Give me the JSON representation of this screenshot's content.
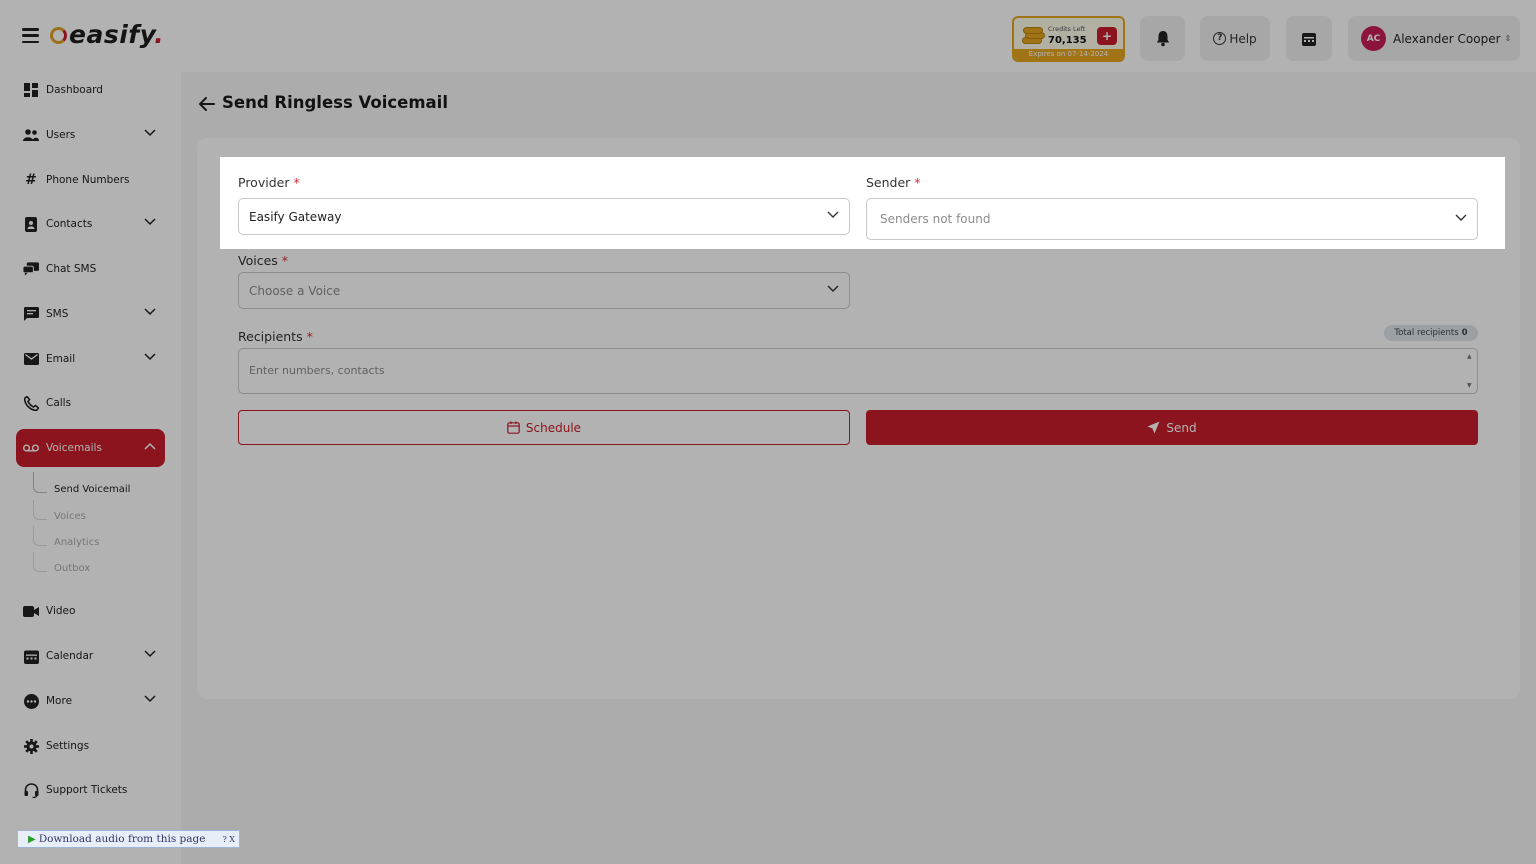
{
  "app": {
    "logo": "easify",
    "logo_dot": "."
  },
  "credits": {
    "label": "Credits Left",
    "value": "70,135",
    "plus": "+",
    "expires": "Expires on 07-14-2024"
  },
  "header": {
    "help_label": "Help",
    "user_initials": "AC",
    "user_name": "Alexander Cooper"
  },
  "sidebar": {
    "items": [
      {
        "label": "Dashboard"
      },
      {
        "label": "Users"
      },
      {
        "label": "Phone Numbers"
      },
      {
        "label": "Contacts"
      },
      {
        "label": "Chat SMS"
      },
      {
        "label": "SMS"
      },
      {
        "label": "Email"
      },
      {
        "label": "Calls"
      },
      {
        "label": "Voicemails"
      },
      {
        "label": "Video"
      },
      {
        "label": "Calendar"
      },
      {
        "label": "More"
      },
      {
        "label": "Settings"
      },
      {
        "label": "Support Tickets"
      }
    ],
    "voicemail_sub": [
      {
        "label": "Send Voicemail"
      },
      {
        "label": "Voices"
      },
      {
        "label": "Analytics"
      },
      {
        "label": "Outbox"
      }
    ]
  },
  "page": {
    "title": "Send Ringless Voicemail"
  },
  "form": {
    "provider_label": "Provider",
    "provider_value": "Easify Gateway",
    "sender_label": "Sender",
    "sender_placeholder": "Senders not found",
    "voices_label": "Voices",
    "voices_placeholder": "Choose a Voice",
    "recipients_label": "Recipients",
    "recipients_placeholder": "Enter numbers, contacts",
    "required_mark": "*",
    "total_recipients_label": "Total recipients",
    "total_recipients_value": "0",
    "schedule_label": "Schedule",
    "send_label": "Send"
  },
  "extension": {
    "download_text": "Download audio from this page",
    "tail": "? X"
  },
  "colors": {
    "accent": "#c71e2c",
    "gold": "#e6a71f"
  }
}
